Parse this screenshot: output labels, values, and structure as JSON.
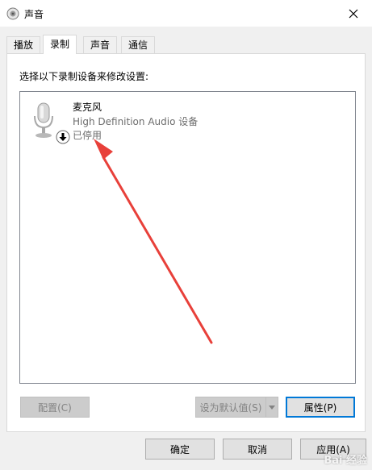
{
  "window": {
    "title": "声音",
    "icon": "speaker-icon",
    "close_icon": "close-icon"
  },
  "tabs": [
    {
      "label": "播放",
      "active": false
    },
    {
      "label": "录制",
      "active": true
    },
    {
      "label": "声音",
      "active": false
    },
    {
      "label": "通信",
      "active": false
    }
  ],
  "recording": {
    "instruction": "选择以下录制设备来修改设置:",
    "devices": [
      {
        "name": "麦克风",
        "description": "High Definition Audio 设备",
        "status": "已停用",
        "icon": "microphone-icon",
        "overlay_icon": "disabled-arrow-down-icon"
      }
    ],
    "buttons": {
      "configure": "配置(C)",
      "set_default": "设为默认值(S)",
      "properties": "属性(P)"
    }
  },
  "footer": {
    "ok": "确定",
    "cancel": "取消",
    "apply": "应用(A)"
  },
  "annotation": {
    "arrow_color": "#e8403a"
  },
  "watermark": "Bai 经验"
}
